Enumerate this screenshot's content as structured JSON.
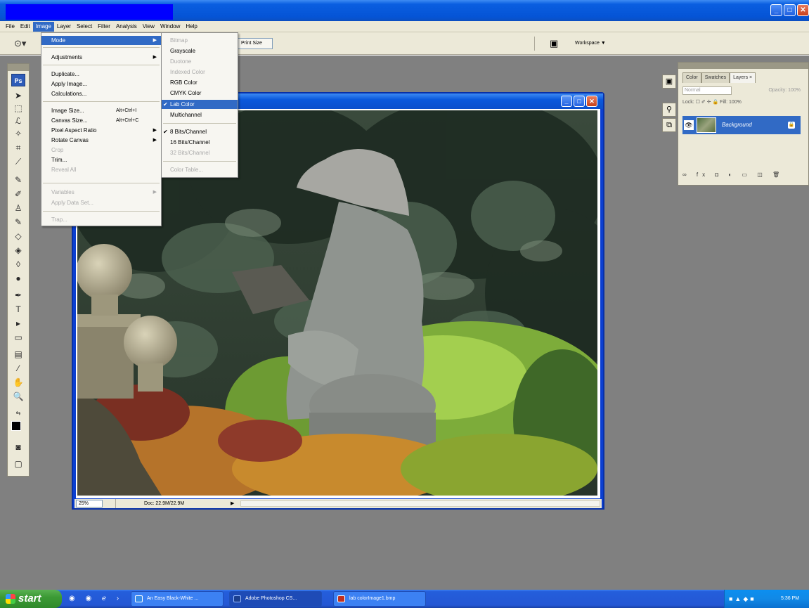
{
  "menubar": {
    "items": [
      "File",
      "Edit",
      "Image",
      "Layer",
      "Select",
      "Filter",
      "Analysis",
      "View",
      "Window",
      "Help"
    ]
  },
  "options_bar": {
    "print_size_label": "Print Size",
    "workspace_label": "Workspace ▼"
  },
  "image_menu": {
    "items": [
      {
        "label": "Mode",
        "highlighted": true,
        "submenu": true
      },
      {
        "label": "Adjustments",
        "submenu": true
      },
      {
        "label": "Duplicate..."
      },
      {
        "label": "Apply Image..."
      },
      {
        "label": "Calculations..."
      },
      {
        "label": "Image Size...",
        "shortcut": "Alt+Ctrl+I"
      },
      {
        "label": "Canvas Size...",
        "shortcut": "Alt+Ctrl+C"
      },
      {
        "label": "Pixel Aspect Ratio",
        "submenu": true
      },
      {
        "label": "Rotate Canvas",
        "submenu": true
      },
      {
        "label": "Crop",
        "disabled": true
      },
      {
        "label": "Trim..."
      },
      {
        "label": "Reveal All",
        "disabled": true
      },
      {
        "label": "Variables",
        "disabled": true,
        "submenu": true
      },
      {
        "label": "Apply Data Set...",
        "disabled": true
      },
      {
        "label": "Trap...",
        "disabled": true
      }
    ]
  },
  "mode_submenu": {
    "items": [
      {
        "label": "Bitmap",
        "disabled": true
      },
      {
        "label": "Grayscale"
      },
      {
        "label": "Duotone",
        "disabled": true
      },
      {
        "label": "Indexed Color",
        "disabled": true
      },
      {
        "label": "RGB Color"
      },
      {
        "label": "CMYK Color"
      },
      {
        "label": "Lab Color",
        "checked": true,
        "highlighted": true
      },
      {
        "label": "Multichannel"
      },
      {
        "label": "8 Bits/Channel",
        "checked": true
      },
      {
        "label": "16 Bits/Channel"
      },
      {
        "label": "32 Bits/Channel",
        "disabled": true
      },
      {
        "label": "Color Table...",
        "disabled": true
      }
    ]
  },
  "toolbox": {
    "logo": "Ps",
    "icons": [
      "move-tool-icon",
      "marquee-tool-icon",
      "lasso-tool-icon",
      "magic-wand-tool-icon",
      "crop-tool-icon",
      "slice-tool-icon",
      "healing-brush-icon",
      "brush-tool-icon",
      "clone-stamp-icon",
      "history-brush-icon",
      "eraser-tool-icon",
      "gradient-tool-icon",
      "blur-tool-icon",
      "dodge-tool-icon",
      "pen-tool-icon",
      "type-tool-icon",
      "path-selection-icon",
      "shape-tool-icon",
      "notes-tool-icon",
      "eyedropper-tool-icon",
      "hand-tool-icon",
      "zoom-tool-icon"
    ]
  },
  "document": {
    "zoom": "25%",
    "doc_info": "Doc: 22.9M/22.9M",
    "buttons": [
      "_",
      "□",
      "✕"
    ]
  },
  "layers_palette": {
    "tabs": [
      "Color",
      "Swatches",
      "Layers ×"
    ],
    "blend_mode": "Normal",
    "opacity_label": "Opacity: 100%",
    "lock_label": "Lock: ☐ ✐ ✛ 🔒   Fill: 100%",
    "layer_name": "Background",
    "footer_icons": "∞ fx ◘ ◐ ▭ ◫ 🗑"
  },
  "taskbar": {
    "start_label": "start",
    "tasks": [
      {
        "label": "An Easy Black-White ...",
        "color": "#3a8de8"
      },
      {
        "label": "Adobe Photoshop CS...",
        "color": "#1c3f8f"
      },
      {
        "label": "lab colorImage1.bmp",
        "color": "#c03020"
      }
    ],
    "clock": "5:36 PM"
  },
  "colors": {
    "xp_blue": "#0554d6",
    "menu_highlight": "#316ac5",
    "workspace_gray": "#808080",
    "chrome": "#ece9d8"
  }
}
